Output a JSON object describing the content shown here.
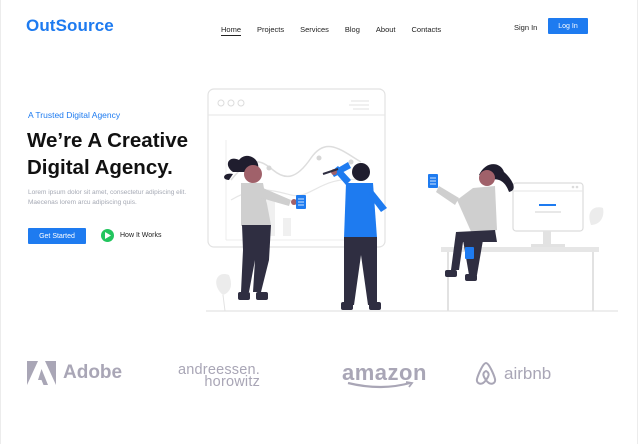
{
  "header": {
    "logo": "OutSource",
    "nav": [
      "Home",
      "Projects",
      "Services",
      "Blog",
      "About",
      "Contacts"
    ],
    "active_nav": "Home",
    "signin": "Sign In",
    "login": "Log In"
  },
  "hero": {
    "eyebrow": "A Trusted Digital Agency",
    "headline_line1": "We’re A Creative",
    "headline_line2": "Digital Agency.",
    "lorem": "Lorem ipsum dolor sit amet, consectetur adipiscing elit. Maecenas lorem arcu adipiscing quis.",
    "cta": "Get Started",
    "how": "How It Works"
  },
  "logos": {
    "adobe": "Adobe",
    "a16z_line1": "andreessen.",
    "a16z_line2": "horowitz",
    "amazon": "amazon",
    "airbnb": "airbnb"
  },
  "colors": {
    "accent": "#1e7bf0",
    "play": "#22c55e",
    "muted": "#a9a6b6"
  }
}
